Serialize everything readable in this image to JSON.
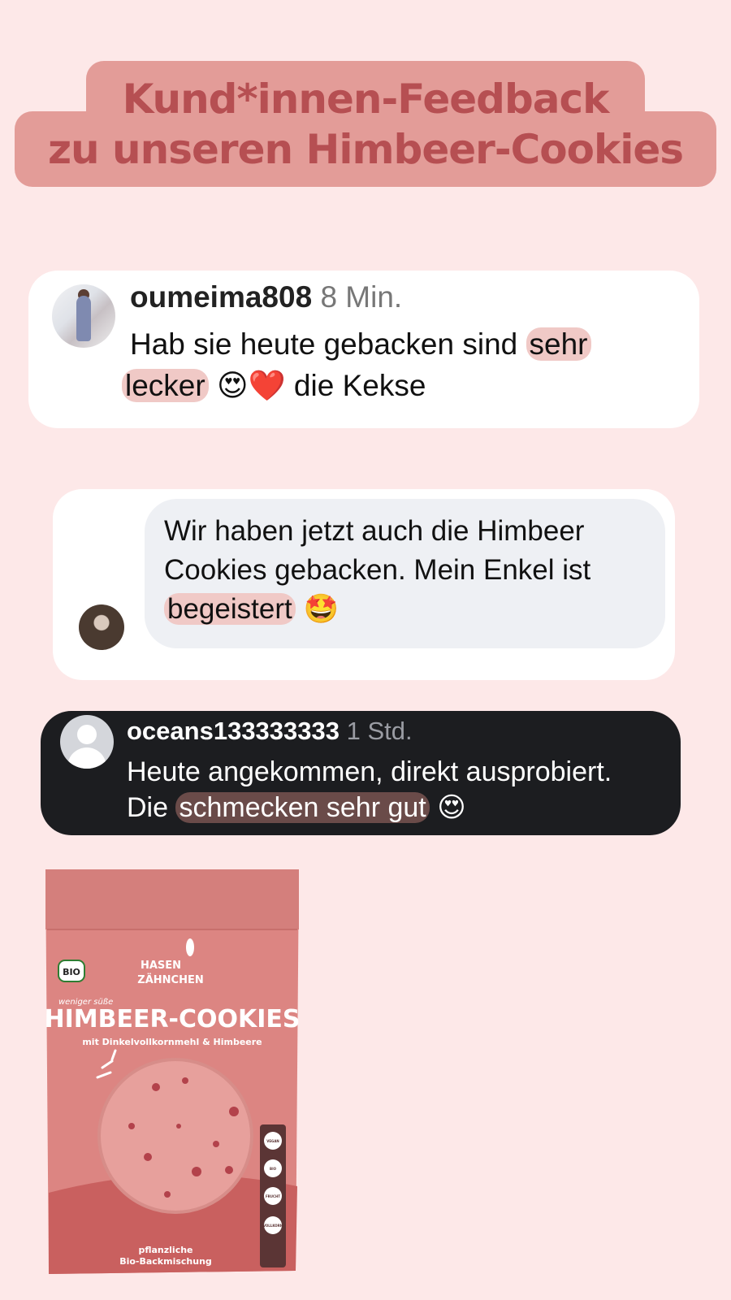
{
  "title": {
    "line1": "Kund*innen-Feedback",
    "line2": "zu unseren Himbeer-Cookies"
  },
  "comments": [
    {
      "username": "oumeima808",
      "time": "8 Min.",
      "text_before": "Hab sie heute gebacken sind",
      "highlight_line1": "sehr",
      "highlight_line2": "lecker",
      "emoji": "😍❤️",
      "text_after": "die Kekse"
    },
    {
      "line1": "Wir haben jetzt auch die Himbeer",
      "line2": "Cookies gebacken. Mein Enkel ist",
      "highlight": "begeistert",
      "emoji": "🤩"
    },
    {
      "username": "oceans133333333",
      "time": "1 Std.",
      "line1": "Heute angekommen, direkt ausprobiert.",
      "prefix": "Die",
      "highlight": "schmecken sehr gut",
      "emoji": "😍"
    }
  ],
  "product": {
    "brand_line1": "HASEN",
    "brand_line2": "ZÄHNCHEN",
    "bio_label": "BIO",
    "pre_title": "weniger süße",
    "name": "HIMBEER-COOKIES",
    "subtitle": "mit Dinkelvollkornmehl & Himbeere",
    "footer_line1": "pflanzliche",
    "footer_line2": "Bio-Backmischung",
    "badges": [
      "VEGAN",
      "BIO",
      "FRUCHT",
      "VOLLKORN"
    ]
  },
  "colors": {
    "background": "#fde8e8",
    "title_box": "#e39c98",
    "title_text": "#b64f52",
    "highlight": "#f0c9c6",
    "dark_card": "#1c1d20",
    "package": "#dc8582"
  }
}
